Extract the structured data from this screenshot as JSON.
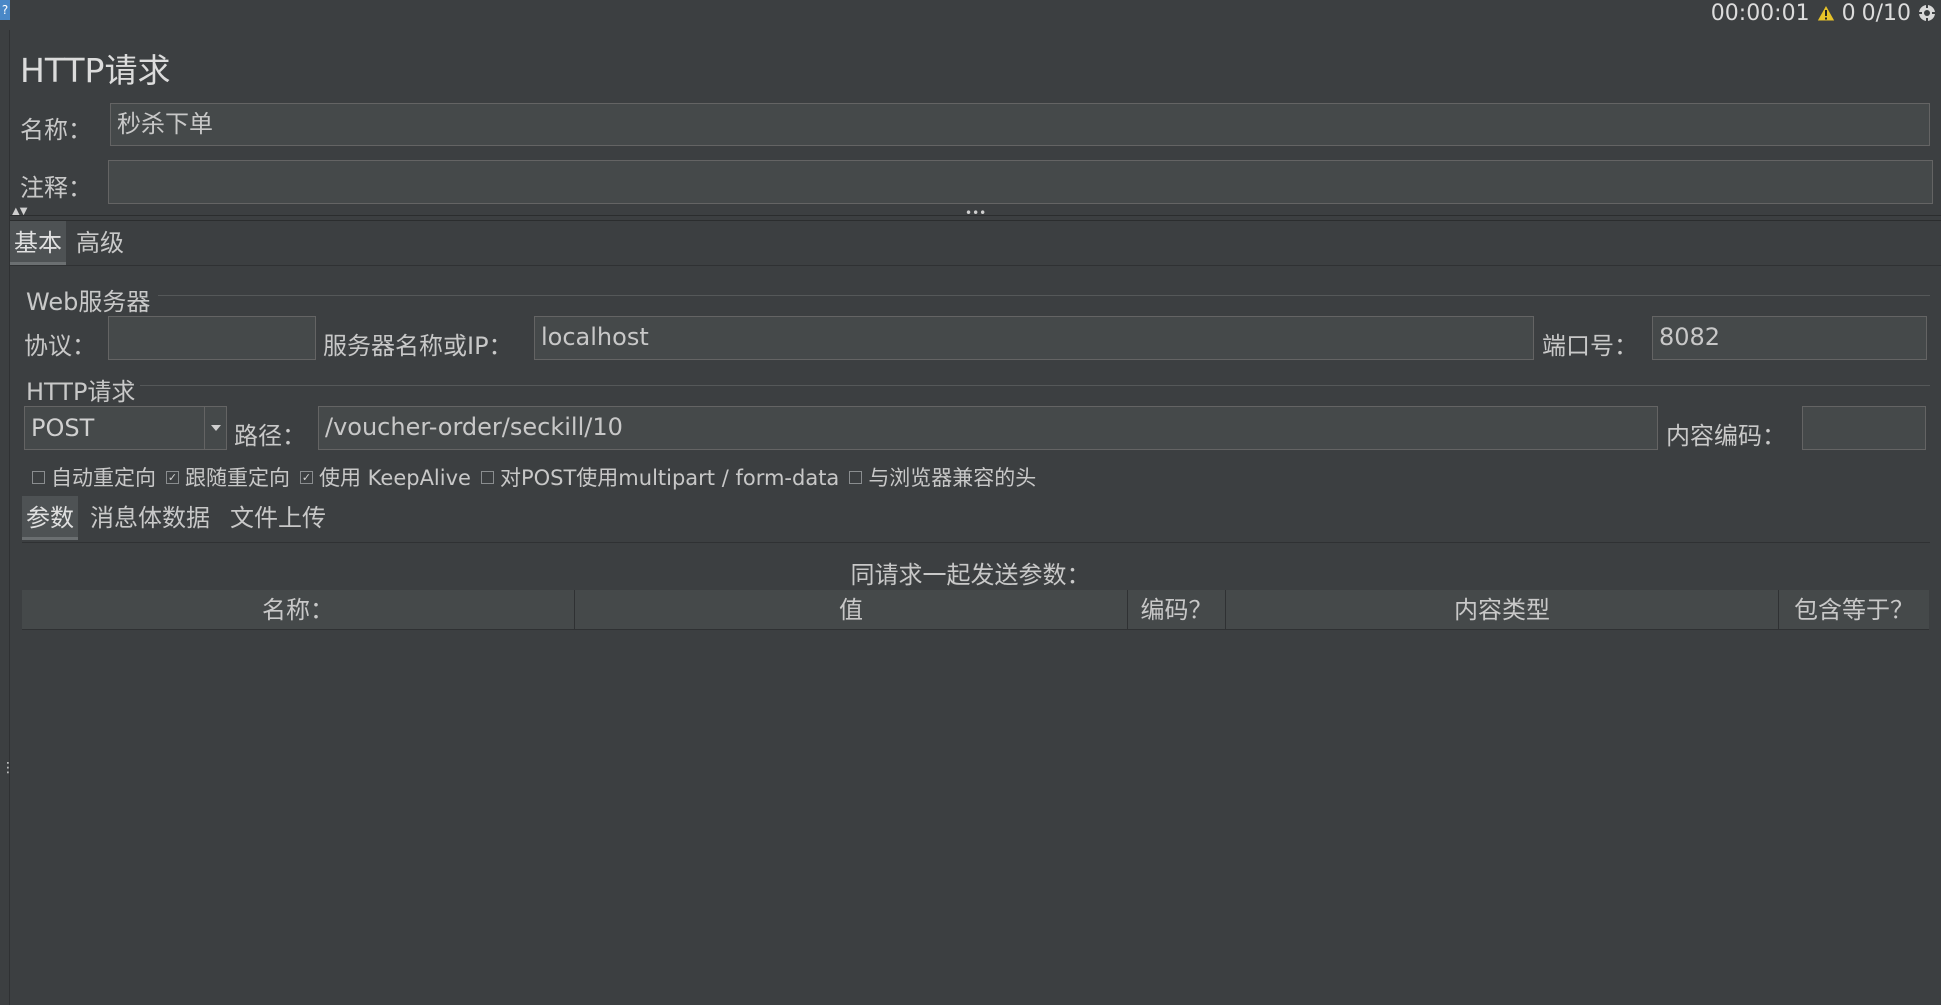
{
  "topbar": {
    "help_label": "?",
    "elapsed": "00:00:01",
    "warnings": "0",
    "threads": "0/10"
  },
  "sampler": {
    "title": "HTTP请求",
    "name_label": "名称：",
    "name_value": "秒杀下单",
    "comment_label": "注释：",
    "comment_value": ""
  },
  "main_tabs": [
    {
      "label": "基本"
    },
    {
      "label": "高级"
    }
  ],
  "web_server": {
    "group_title": "Web服务器",
    "protocol_label": "协议：",
    "protocol_value": "",
    "server_label": "服务器名称或IP：",
    "server_value": "localhost",
    "port_label": "端口号：",
    "port_value": "8082"
  },
  "http_request": {
    "group_title": "HTTP请求",
    "method": "POST",
    "path_label": "路径：",
    "path_value": "/voucher-order/seckill/10",
    "encoding_label": "内容编码：",
    "encoding_value": ""
  },
  "options": [
    {
      "label": "自动重定向",
      "checked": false
    },
    {
      "label": "跟随重定向",
      "checked": true
    },
    {
      "label": "使用 KeepAlive",
      "checked": true
    },
    {
      "label": "对POST使用multipart / form-data",
      "checked": false
    },
    {
      "label": "与浏览器兼容的头",
      "checked": false
    }
  ],
  "sub_tabs": [
    {
      "label": "参数"
    },
    {
      "label": "消息体数据"
    },
    {
      "label": "文件上传"
    }
  ],
  "params_table": {
    "caption": "同请求一起发送参数：",
    "columns": [
      "名称：",
      "值",
      "编码？",
      "内容类型",
      "包含等于？"
    ]
  }
}
